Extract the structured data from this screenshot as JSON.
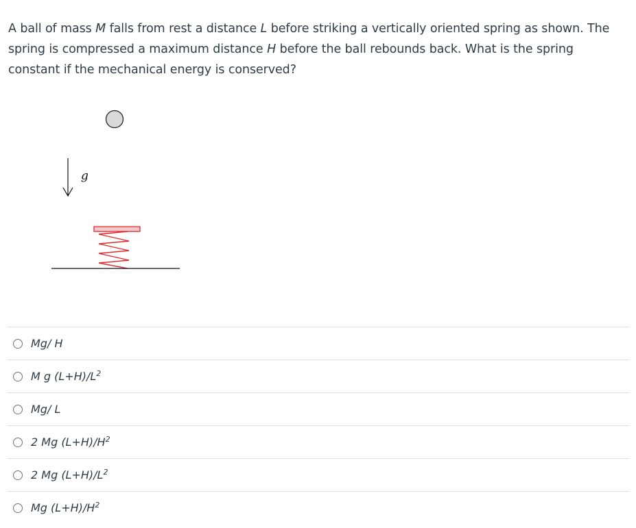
{
  "question": {
    "segments": [
      {
        "t": "A ball of mass ",
        "i": false
      },
      {
        "t": "M",
        "i": true
      },
      {
        "t": " falls from rest a distance ",
        "i": false
      },
      {
        "t": "L",
        "i": true
      },
      {
        "t": " before striking a vertically oriented spring as shown.   The spring is compressed a maximum distance ",
        "i": false
      },
      {
        "t": "H",
        "i": true
      },
      {
        "t": " before the ball rebounds back.   What is the spring constant if the mechanical energy is conserved?",
        "i": false
      }
    ]
  },
  "figure": {
    "gravity_label": "g",
    "ball_color": "#d9d9d9",
    "spring_color": "#e8262a",
    "plate_fill": "#f3c9cc"
  },
  "answers": [
    {
      "main": "Mg/ H",
      "sup": ""
    },
    {
      "main": "M g (L+H)/L",
      "sup": "2"
    },
    {
      "main": "Mg/ L",
      "sup": ""
    },
    {
      "main": "2 Mg (L+H)/H",
      "sup": "2"
    },
    {
      "main": "2 Mg (L+H)/L",
      "sup": "2"
    },
    {
      "main": "Mg (L+H)/H",
      "sup": "2"
    }
  ]
}
